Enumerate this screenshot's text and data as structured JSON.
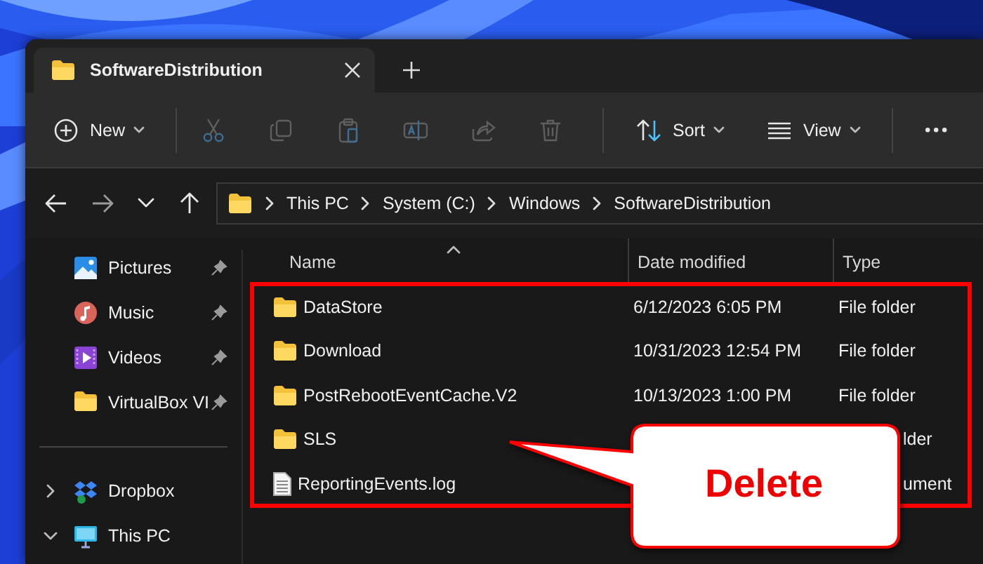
{
  "window": {
    "tabs": [
      {
        "label": "SoftwareDistribution",
        "selected": true
      }
    ]
  },
  "toolbar": {
    "groups": [
      [
        {
          "label": "New",
          "disabled": false
        }
      ],
      [
        {
          "disabled": true
        },
        {
          "disabled": true
        },
        {
          "disabled": true
        },
        {
          "disabled": true
        },
        {
          "disabled": true
        },
        {
          "disabled": true
        }
      ],
      [
        {
          "label": "Sort",
          "disabled": false
        },
        {
          "label": "View",
          "disabled": false
        }
      ],
      [
        {
          "disabled": false
        }
      ]
    ]
  },
  "address_bar": {
    "path": [
      "This PC",
      "System (C:)",
      "Windows",
      "SoftwareDistribution"
    ]
  },
  "sidebar": {
    "items": [
      {
        "kind": "pinned",
        "label": "Pictures"
      },
      {
        "kind": "pinned",
        "label": "Music"
      },
      {
        "kind": "pinned",
        "label": "Videos"
      },
      {
        "kind": "pinned",
        "label": "VirtualBox VI"
      },
      {
        "kind": "divider"
      },
      {
        "kind": "tree",
        "label": "Dropbox",
        "expanded": false
      },
      {
        "kind": "tree",
        "label": "This PC",
        "expanded": true
      }
    ]
  },
  "table": {
    "columns": [
      "Name",
      "Date modified",
      "Type"
    ],
    "rows": [
      {
        "kind": "folder",
        "name": "DataStore",
        "date": "6/12/2023 6:05 PM",
        "type": "File folder"
      },
      {
        "kind": "folder",
        "name": "Download",
        "date": "10/31/2023 12:54 PM",
        "type": "File folder"
      },
      {
        "kind": "folder",
        "name": "PostRebootEventCache.V2",
        "date": "10/13/2023 1:00 PM",
        "type": "File folder"
      },
      {
        "kind": "folder",
        "name": "SLS",
        "type": "lder"
      },
      {
        "kind": "file",
        "name": "ReportingEvents.log",
        "type": "ument"
      }
    ]
  },
  "callout": {
    "text": "Delete"
  }
}
